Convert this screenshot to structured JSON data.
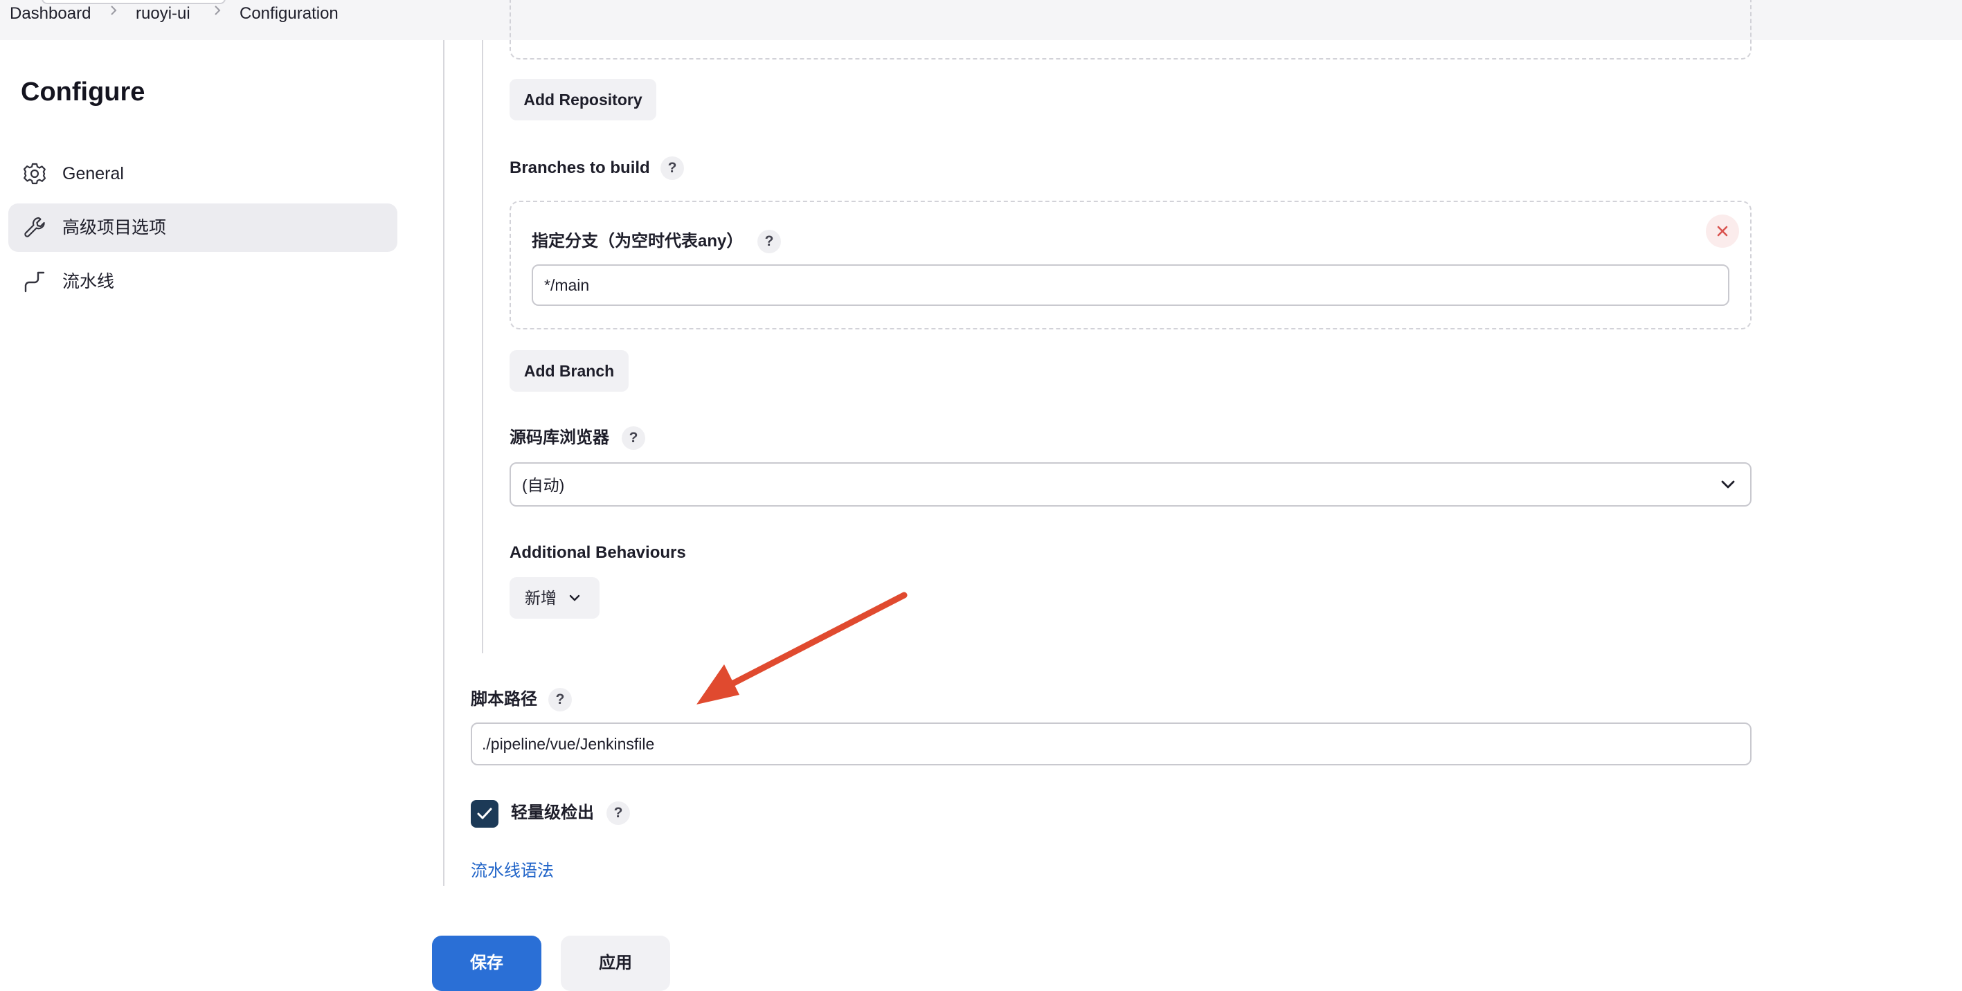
{
  "breadcrumb": {
    "items": [
      "Dashboard",
      "ruoyi-ui",
      "Configuration"
    ]
  },
  "sidebar": {
    "title": "Configure",
    "items": [
      {
        "label": "General",
        "icon": "gear-icon",
        "active": false
      },
      {
        "label": "高级项目选项",
        "icon": "wrench-icon",
        "active": true
      },
      {
        "label": "流水线",
        "icon": "pipeline-icon",
        "active": false
      }
    ]
  },
  "scm": {
    "add_repository_label": "Add Repository",
    "branches_label": "Branches to build",
    "branch_specifier_label": "指定分支（为空时代表any）",
    "branch_specifier_value": "*/main",
    "add_branch_label": "Add Branch",
    "repo_browser_label": "源码库浏览器",
    "repo_browser_value": "(自动)",
    "additional_behaviours_label": "Additional Behaviours",
    "add_behaviour_label": "新增"
  },
  "script_path": {
    "label": "脚本路径",
    "value": "./pipeline/vue/Jenkinsfile"
  },
  "lightweight_checkout": {
    "label": "轻量级检出",
    "checked": true
  },
  "help_glyph": "?",
  "pipeline_syntax_link": "流水线语法",
  "actions": {
    "save_label": "保存",
    "apply_label": "应用"
  },
  "colors": {
    "accent": "#2a6fd6",
    "checkbox": "#1c3a57",
    "link": "#1f63c8",
    "annotation_arrow": "#e04a2f",
    "delete": "#d9534f"
  }
}
